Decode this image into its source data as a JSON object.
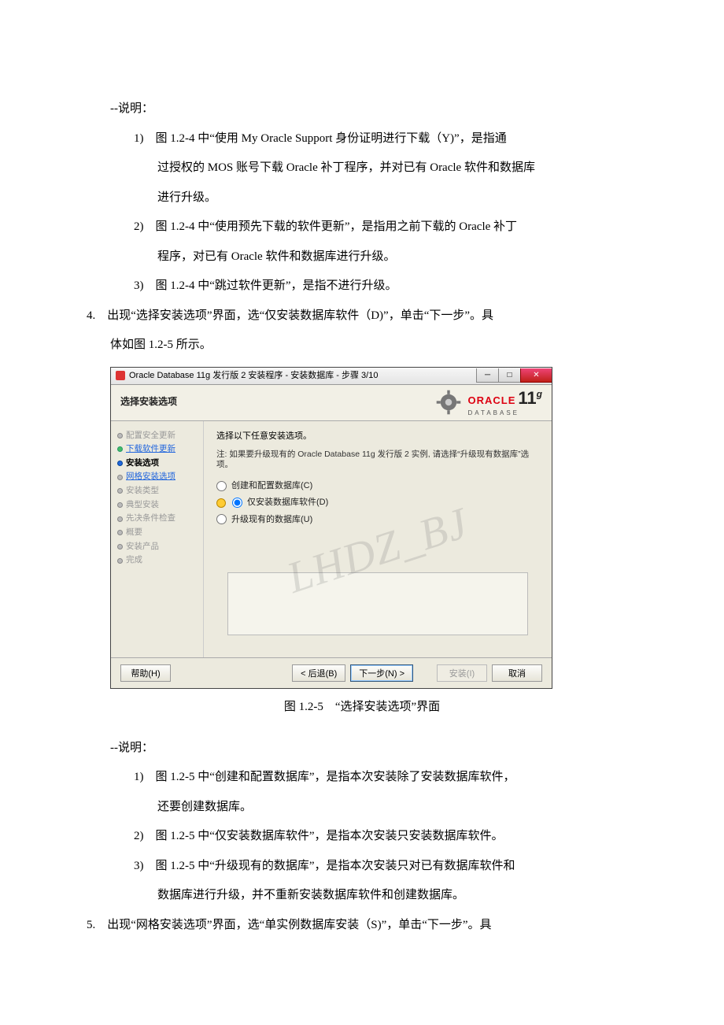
{
  "doc": {
    "note_label": "--说明：",
    "list1": {
      "i1": "1)　图 1.2-4 中“使用 My Oracle Support 身份证明进行下载（Y)”，是指通",
      "i1b": "过授权的 MOS 账号下载 Oracle 补丁程序，并对已有 Oracle 软件和数据库",
      "i1c": "进行升级。",
      "i2": "2)　图 1.2-4 中“使用预先下载的软件更新”，是指用之前下载的 Oracle 补丁",
      "i2b": "程序，对已有 Oracle 软件和数据库进行升级。",
      "i3": "3)　图 1.2-4 中“跳过软件更新”，是指不进行升级。"
    },
    "p4a": "4.　出现“选择安装选项”界面，选“仅安装数据库软件（D)”，单击“下一步”。具",
    "p4b": "体如图 1.2-5 所示。",
    "fig_caption": "图 1.2-5　“选择安装选项”界面",
    "note_label2": "--说明：",
    "list2": {
      "i1": "1)　图 1.2-5 中“创建和配置数据库”，是指本次安装除了安装数据库软件，",
      "i1b": "还要创建数据库。",
      "i2": "2)　图 1.2-5 中“仅安装数据库软件”，是指本次安装只安装数据库软件。",
      "i3": "3)　图 1.2-5 中“升级现有的数据库”，是指本次安装只对已有数据库软件和",
      "i3b": "数据库进行升级，并不重新安装数据库软件和创建数据库。"
    },
    "p5": "5.　出现“网格安装选项”界面，选“单实例数据库安装（S)”，单击“下一步”。具"
  },
  "shot": {
    "title": "Oracle Database 11g 发行版 2 安装程序 - 安装数据库 - 步骤 3/10",
    "header": "选择安装选项",
    "brand_oracle": "ORACLE",
    "brand_db": "DATABASE",
    "steps": {
      "s1": "配置安全更新",
      "s2": "下载软件更新",
      "s3": "安装选项",
      "s4": "网格安装选项",
      "s5": "安装类型",
      "s6": "典型安装",
      "s7": "先决条件检查",
      "s8": "概要",
      "s9": "安装产品",
      "s10": "完成"
    },
    "content": {
      "desc": "选择以下任意安装选项。",
      "note": "注: 如果要升级现有的 Oracle Database 11g 发行版 2 实例, 请选择“升级现有数据库”选项。",
      "r1": "创建和配置数据库(C)",
      "r2": "仅安装数据库软件(D)",
      "r3": "升级现有的数据库(U)"
    },
    "watermark": "LHDZ_BJ",
    "buttons": {
      "help": "帮助(H)",
      "back": "< 后退(B)",
      "next": "下一步(N) >",
      "install": "安装(I)",
      "cancel": "取消"
    }
  }
}
